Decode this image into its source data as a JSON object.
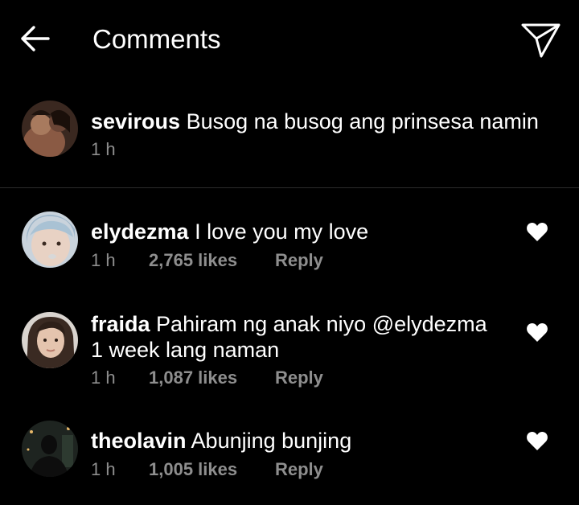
{
  "header": {
    "title": "Comments",
    "back_icon": "arrow-left-icon",
    "send_icon": "paper-plane-icon"
  },
  "caption": {
    "username": "sevirous",
    "text": "Busog na busog ang prinsesa namin",
    "time": "1 h"
  },
  "comments": [
    {
      "username": "elydezma",
      "text": "I love you my love",
      "time": "1 h",
      "likes": "2,765 likes",
      "reply": "Reply"
    },
    {
      "username": "fraida",
      "text_line1": "Pahiram ng anak niyo @elydezma",
      "text_line2": "1 week lang naman",
      "time": "1 h",
      "likes": "1,087 likes",
      "reply": "Reply"
    },
    {
      "username": "theolavin",
      "text": "Abunjing bunjing",
      "time": "1 h",
      "likes": "1,005 likes",
      "reply": "Reply"
    }
  ],
  "colors": {
    "background": "#000000",
    "text": "#ffffff",
    "secondary": "#8e8e8e",
    "divider": "#2b2b2b"
  }
}
